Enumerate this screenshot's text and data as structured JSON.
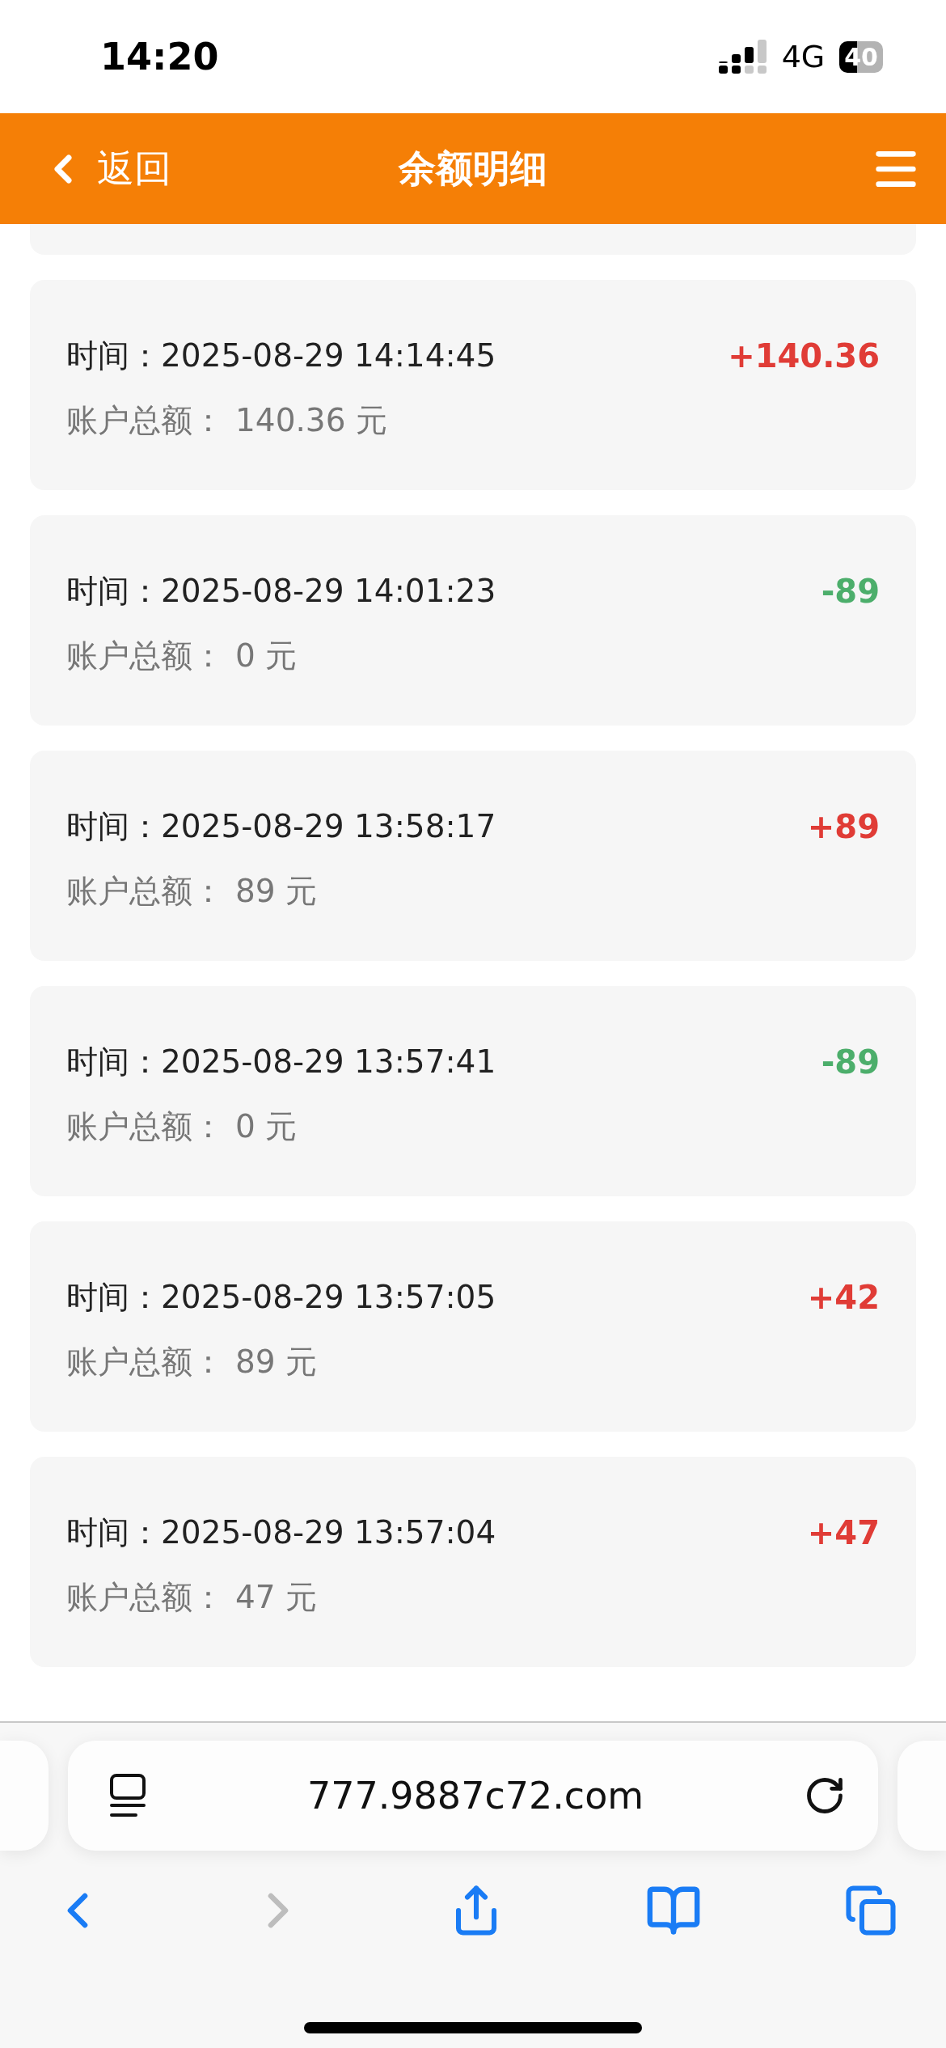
{
  "status_bar": {
    "time": "14:20",
    "network": "4G",
    "battery": "40"
  },
  "header": {
    "back_label": "返回",
    "title": "余额明细"
  },
  "records": [
    {
      "time_label": "时间：",
      "time": "2025-08-29 14:14:45",
      "total_label": "账户总额：",
      "total": "140.36 元",
      "amount": "+140.36",
      "kind": "credit"
    },
    {
      "time_label": "时间：",
      "time": "2025-08-29 14:01:23",
      "total_label": "账户总额：",
      "total": "0 元",
      "amount": "-89",
      "kind": "debit"
    },
    {
      "time_label": "时间：",
      "time": "2025-08-29 13:58:17",
      "total_label": "账户总额：",
      "total": "89 元",
      "amount": "+89",
      "kind": "credit"
    },
    {
      "time_label": "时间：",
      "time": "2025-08-29 13:57:41",
      "total_label": "账户总额：",
      "total": "0 元",
      "amount": "-89",
      "kind": "debit"
    },
    {
      "time_label": "时间：",
      "time": "2025-08-29 13:57:05",
      "total_label": "账户总额：",
      "total": "89 元",
      "amount": "+42",
      "kind": "credit"
    },
    {
      "time_label": "时间：",
      "time": "2025-08-29 13:57:04",
      "total_label": "账户总额：",
      "total": "47 元",
      "amount": "+47",
      "kind": "credit"
    }
  ],
  "browser": {
    "url": "777.9887c72.com",
    "back_disabled": false,
    "forward_disabled": true
  }
}
